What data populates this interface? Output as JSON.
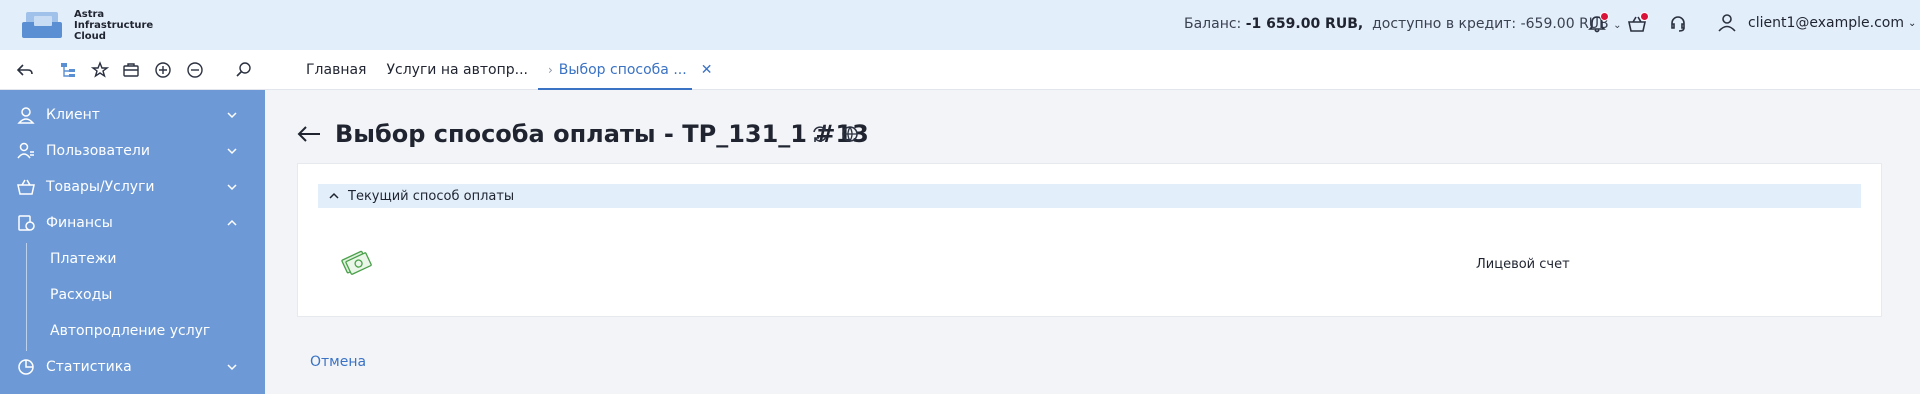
{
  "brand": {
    "line1": "Astra",
    "line2": "Infrastructure",
    "line3": "Cloud"
  },
  "header": {
    "balance_label": "Баланс:",
    "balance_value": "-1 659.00 RUB,",
    "credit_label": "доступно в кредит:",
    "credit_value": "-659.00 RUB",
    "user_email": "client1@example.com",
    "icons": [
      "bell-icon",
      "basket-icon",
      "support-icon",
      "user-icon"
    ],
    "accent_color": "#3a72c4",
    "notification_color": "#d9123a"
  },
  "toolbar": {
    "icons": [
      "back-icon",
      "tree-icon",
      "star-icon",
      "briefcase-icon",
      "plus-circle-icon",
      "minus-circle-icon",
      "search-icon"
    ]
  },
  "tabs": [
    {
      "label": "Главная"
    },
    {
      "label": "Услуги на автопр..."
    },
    {
      "label": "Выбор способа ..."
    }
  ],
  "sidebar": {
    "items": [
      {
        "label": "Клиент",
        "icon": "client-icon",
        "expanded": false
      },
      {
        "label": "Пользователи",
        "icon": "users-icon",
        "expanded": false
      },
      {
        "label": "Товары/Услуги",
        "icon": "basket-icon",
        "expanded": false
      },
      {
        "label": "Финансы",
        "icon": "finance-icon",
        "expanded": true
      },
      {
        "label": "Статистика",
        "icon": "chart-icon",
        "expanded": false
      }
    ],
    "finance_sub": [
      {
        "label": "Платежи"
      },
      {
        "label": "Расходы"
      },
      {
        "label": "Автопродление услуг"
      }
    ],
    "bg_color": "#6d9ad6"
  },
  "main": {
    "title": "Выбор способа оплаты - TP_131_1 #13",
    "section_title": "Текущий способ оплаты",
    "payment_method": "Лицевой счет",
    "cancel_label": "Отмена"
  }
}
